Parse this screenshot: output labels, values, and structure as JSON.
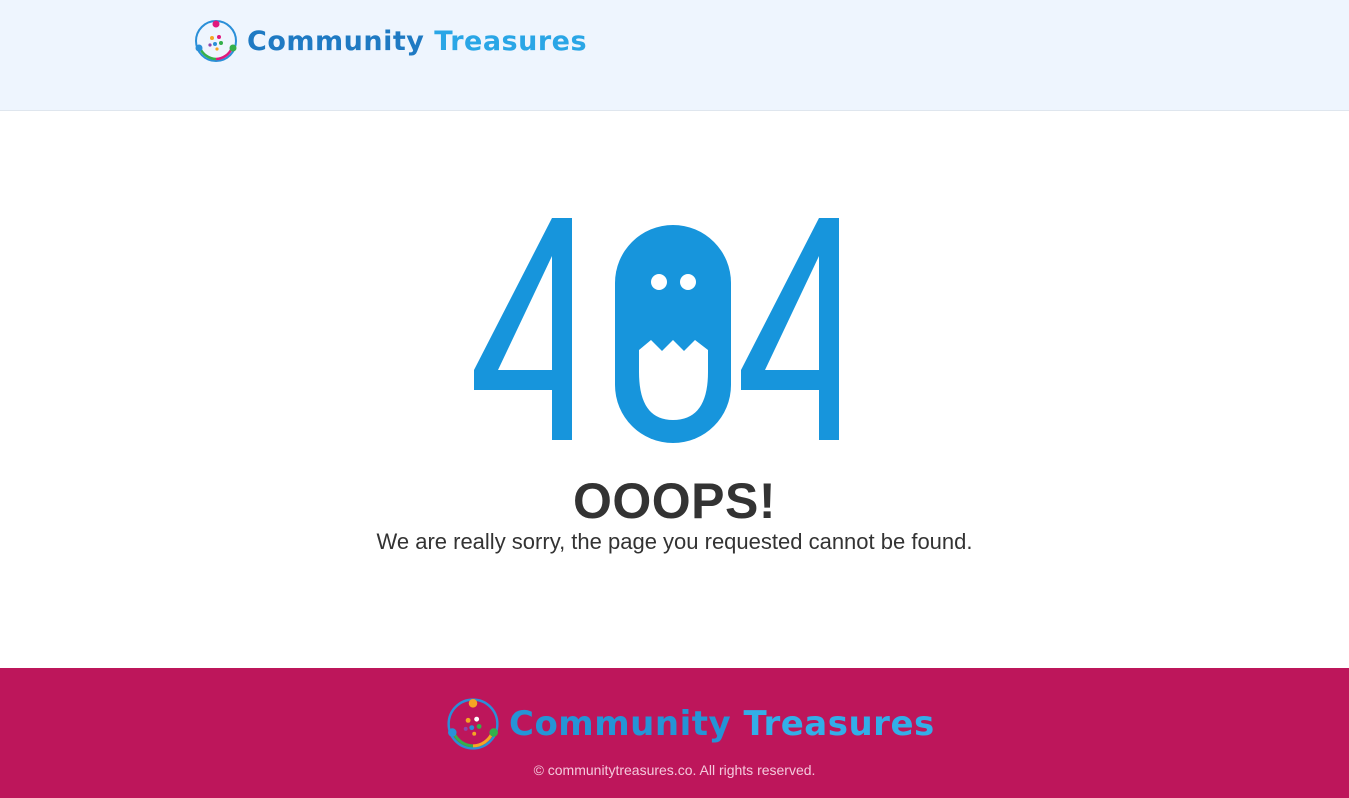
{
  "header": {
    "logo": {
      "word1": "Community",
      "word2": "Treasures"
    }
  },
  "error": {
    "code": "404",
    "heading": "OOOPS!",
    "message": "We are really sorry, the page you requested cannot be found."
  },
  "footer": {
    "logo": {
      "word1": "Community",
      "word2": "Treasures"
    },
    "copyright": "© communitytreasures.co. All rights reserved."
  },
  "colors": {
    "header_bg": "#eef5fe",
    "accent_blue": "#1795dc",
    "footer_bg": "#bd165b",
    "text_dark": "#333333"
  },
  "icons": [
    "community-logo-icon",
    "ghost-zero-icon"
  ]
}
